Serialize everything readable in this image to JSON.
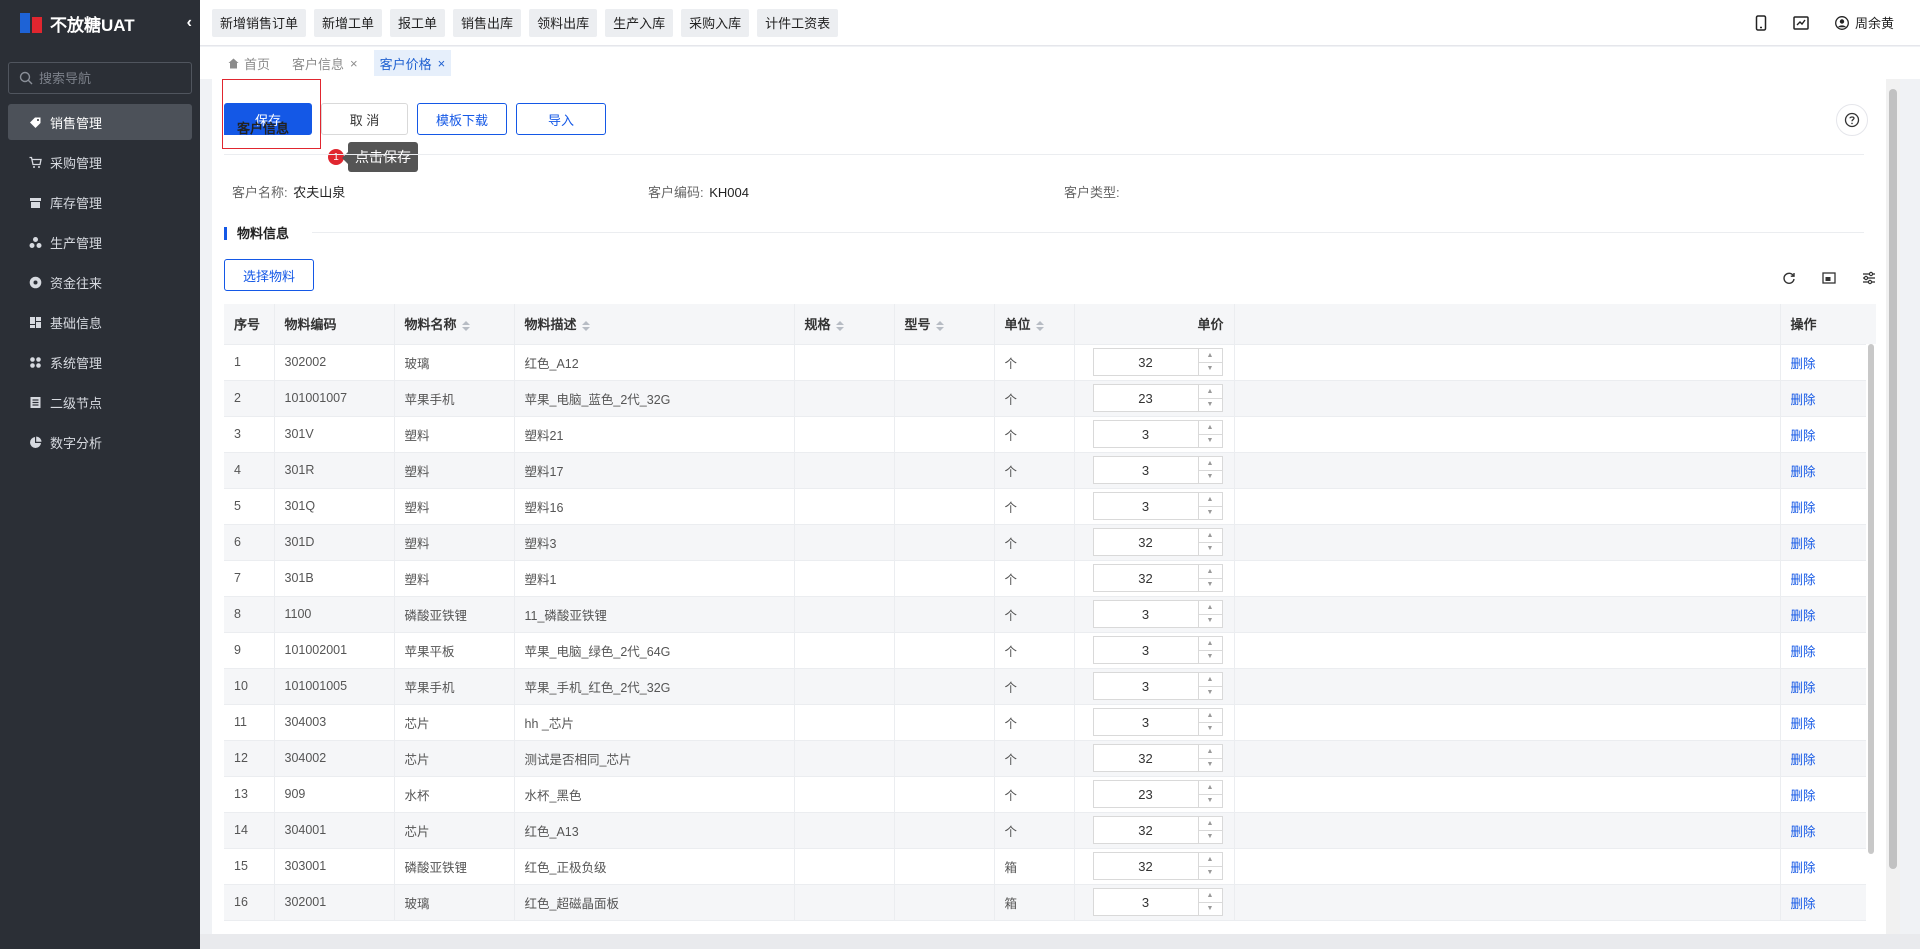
{
  "sidebar": {
    "app_name": "不放糖UAT",
    "search_placeholder": "搜索导航",
    "items": [
      {
        "label": "销售管理",
        "icon": "tag-icon",
        "active": true
      },
      {
        "label": "采购管理",
        "icon": "cart-icon"
      },
      {
        "label": "库存管理",
        "icon": "inventory-icon"
      },
      {
        "label": "生产管理",
        "icon": "production-icon"
      },
      {
        "label": "资金往来",
        "icon": "money-icon"
      },
      {
        "label": "基础信息",
        "icon": "grid-icon"
      },
      {
        "label": "系统管理",
        "icon": "apps-icon"
      },
      {
        "label": "二级节点",
        "icon": "list-icon"
      },
      {
        "label": "数字分析",
        "icon": "pie-chart-icon"
      }
    ]
  },
  "topbar": {
    "quick_buttons": [
      "新增销售订单",
      "新增工单",
      "报工单",
      "销售出库",
      "领料出库",
      "生产入库",
      "采购入库",
      "计件工资表"
    ],
    "user_name": "周余黄"
  },
  "tabs": {
    "items": [
      {
        "label": "首页",
        "home": true
      },
      {
        "label": "客户信息",
        "closable": true
      },
      {
        "label": "客户价格",
        "closable": true,
        "active": true
      }
    ]
  },
  "toolbar": {
    "save": "保存",
    "cancel": "取 消",
    "template_download": "模板下载",
    "import": "导入"
  },
  "tip": {
    "number": "1",
    "text": "点击保存"
  },
  "customer_section": {
    "title": "客户信息",
    "name_label": "客户名称:",
    "name_value": "农夫山泉",
    "code_label": "客户编码:",
    "code_value": "KH004",
    "type_label": "客户类型:",
    "type_value": ""
  },
  "material_section": {
    "title": "物料信息",
    "select_button": "选择物料"
  },
  "table": {
    "columns": [
      "序号",
      "物料编码",
      "物料名称",
      "物料描述",
      "规格",
      "型号",
      "单位",
      "单价",
      "操作"
    ],
    "delete_label": "删除",
    "rows": [
      {
        "no": "1",
        "code": "302002",
        "name": "玻璃",
        "desc": "红色_A12",
        "spec": "",
        "model": "",
        "unit": "个",
        "price": "32"
      },
      {
        "no": "2",
        "code": "101001007",
        "name": "苹果手机",
        "desc": "苹果_电脑_蓝色_2代_32G",
        "spec": "",
        "model": "",
        "unit": "个",
        "price": "23"
      },
      {
        "no": "3",
        "code": "301V",
        "name": "塑料",
        "desc": "塑料21",
        "spec": "",
        "model": "",
        "unit": "个",
        "price": "3"
      },
      {
        "no": "4",
        "code": "301R",
        "name": "塑料",
        "desc": "塑料17",
        "spec": "",
        "model": "",
        "unit": "个",
        "price": "3"
      },
      {
        "no": "5",
        "code": "301Q",
        "name": "塑料",
        "desc": "塑料16",
        "spec": "",
        "model": "",
        "unit": "个",
        "price": "3"
      },
      {
        "no": "6",
        "code": "301D",
        "name": "塑料",
        "desc": "塑料3",
        "spec": "",
        "model": "",
        "unit": "个",
        "price": "32"
      },
      {
        "no": "7",
        "code": "301B",
        "name": "塑料",
        "desc": "塑料1",
        "spec": "",
        "model": "",
        "unit": "个",
        "price": "32"
      },
      {
        "no": "8",
        "code": "1100",
        "name": "磷酸亚铁锂",
        "desc": "11_磷酸亚铁锂",
        "spec": "",
        "model": "",
        "unit": "个",
        "price": "3"
      },
      {
        "no": "9",
        "code": "101002001",
        "name": "苹果平板",
        "desc": "苹果_电脑_绿色_2代_64G",
        "spec": "",
        "model": "",
        "unit": "个",
        "price": "3"
      },
      {
        "no": "10",
        "code": "101001005",
        "name": "苹果手机",
        "desc": "苹果_手机_红色_2代_32G",
        "spec": "",
        "model": "",
        "unit": "个",
        "price": "3"
      },
      {
        "no": "11",
        "code": "304003",
        "name": "芯片",
        "desc": "hh _芯片",
        "spec": "",
        "model": "",
        "unit": "个",
        "price": "3"
      },
      {
        "no": "12",
        "code": "304002",
        "name": "芯片",
        "desc": "测试是否相同_芯片",
        "spec": "",
        "model": "",
        "unit": "个",
        "price": "32"
      },
      {
        "no": "13",
        "code": "909",
        "name": "水杯",
        "desc": "水杯_黑色",
        "spec": "",
        "model": "",
        "unit": "个",
        "price": "23"
      },
      {
        "no": "14",
        "code": "304001",
        "name": "芯片",
        "desc": "红色_A13",
        "spec": "",
        "model": "",
        "unit": "个",
        "price": "32"
      },
      {
        "no": "15",
        "code": "303001",
        "name": "磷酸亚铁锂",
        "desc": "红色_正极负级",
        "spec": "",
        "model": "",
        "unit": "箱",
        "price": "32"
      },
      {
        "no": "16",
        "code": "302001",
        "name": "玻璃",
        "desc": "红色_超磁晶面板",
        "spec": "",
        "model": "",
        "unit": "箱",
        "price": "3"
      }
    ]
  },
  "colors": {
    "primary": "#1458e6",
    "sidebar_bg": "#2b2f36",
    "highlight": "#e0262f"
  }
}
